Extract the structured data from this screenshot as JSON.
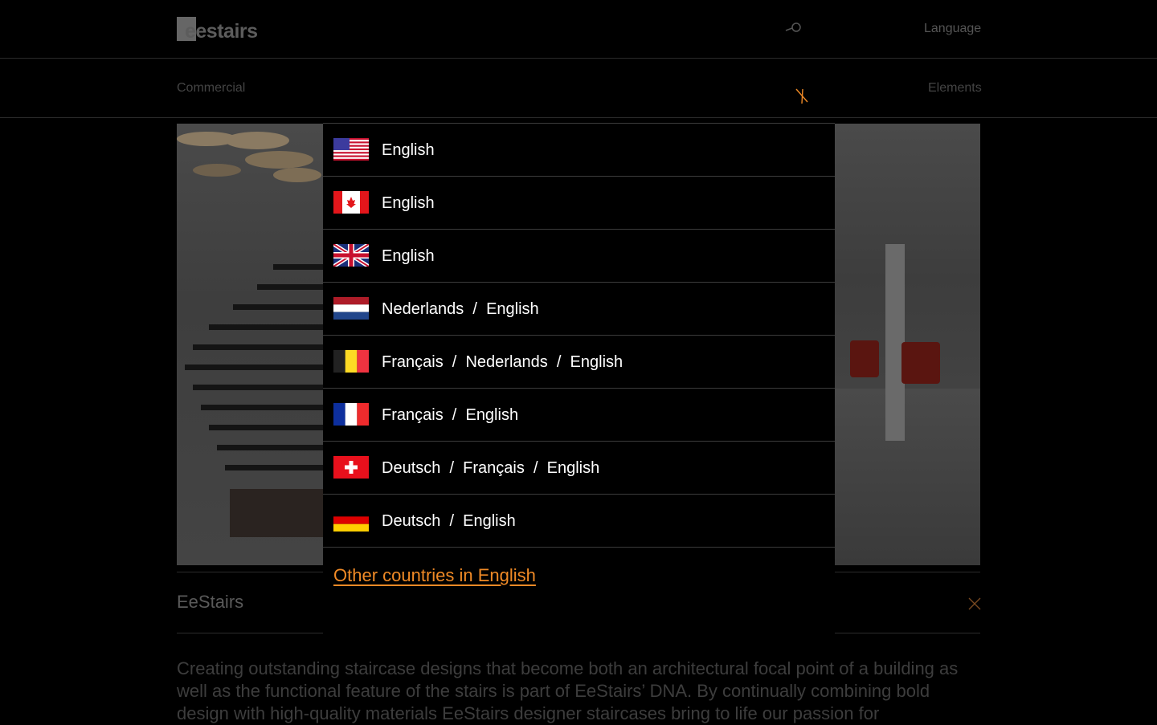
{
  "header": {
    "logo_text": "eestairs",
    "language_label": "Language"
  },
  "subnav": {
    "left_label": "Commercial",
    "right_label": "Elements"
  },
  "card": {
    "title": "EeStairs",
    "intro": "Creating outstanding staircase designs that become both an architectural focal point of a building as well as the functional feature of the stairs is part of EeStairs’ DNA. By continually combining bold design with high-quality materials EeStairs designer staircases bring to life our passion for"
  },
  "language_modal": {
    "options": [
      {
        "flag": "flag-us-icon",
        "label": "English"
      },
      {
        "flag": "flag-canada-icon",
        "label": "English"
      },
      {
        "flag": "flag-uk-icon",
        "label": "English"
      },
      {
        "flag": "flag-netherlands-icon",
        "label": "Nederlands  /  English"
      },
      {
        "flag": "flag-belgium-icon",
        "label": "Français  /  Nederlands  /  English"
      },
      {
        "flag": "flag-france-icon",
        "label": "Français  /  English"
      },
      {
        "flag": "flag-switzerland-icon",
        "label": "Deutsch  /  Français  /  English"
      },
      {
        "flag": "flag-germany-icon",
        "label": "Deutsch  /  English"
      }
    ],
    "other_link": "Other countries in English"
  },
  "colors": {
    "accent": "#f08a26",
    "background": "#000000",
    "divider": "#3c3c3c"
  }
}
